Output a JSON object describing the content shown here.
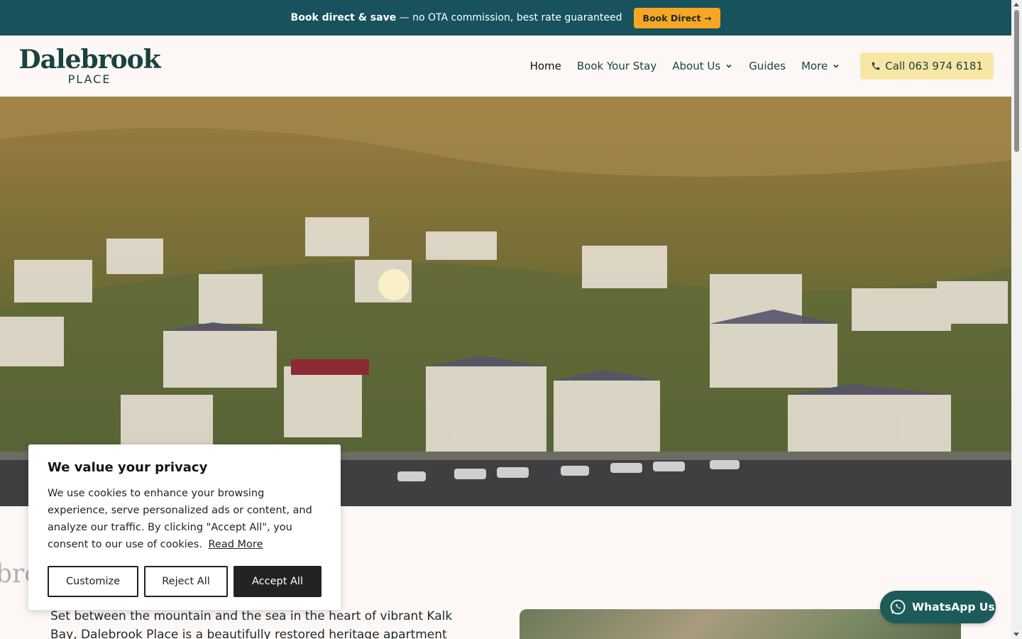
{
  "promo": {
    "bold": "Book direct & save",
    "rest": "— no OTA commission, best rate guaranteed",
    "button": "Book Direct →"
  },
  "header": {
    "logo_main": "Dalebrook",
    "logo_sub": "PLACE",
    "nav": [
      {
        "label": "Home"
      },
      {
        "label": "Book Your Stay"
      },
      {
        "label": "About Us"
      },
      {
        "label": "Guides"
      },
      {
        "label": "More"
      }
    ],
    "call": "Call 063 974 6181"
  },
  "content": {
    "bg_text": "broc",
    "intro": "Set between the mountain and the sea in the heart of vibrant Kalk Bay, Dalebrook Place is a beautifully restored heritage apartment building"
  },
  "cookie": {
    "title": "We value your privacy",
    "body": "We use cookies to enhance your browsing experience, serve personalized ads or content, and analyze our traffic. By clicking \"Accept All\", you consent to our use of cookies.",
    "read_more": "Read More",
    "customize": "Customize",
    "reject": "Reject All",
    "accept": "Accept All"
  },
  "whatsapp": {
    "label": "WhatsApp Us"
  },
  "icons": {
    "phone": "phone-icon",
    "whatsapp": "whatsapp-icon",
    "chevron": "chevron-down-icon"
  },
  "colors": {
    "banner": "#17525d",
    "promo_button": "#f5a623",
    "call_button": "#f8e6a4",
    "brand": "#18433f",
    "whatsapp": "#1c5b59"
  }
}
